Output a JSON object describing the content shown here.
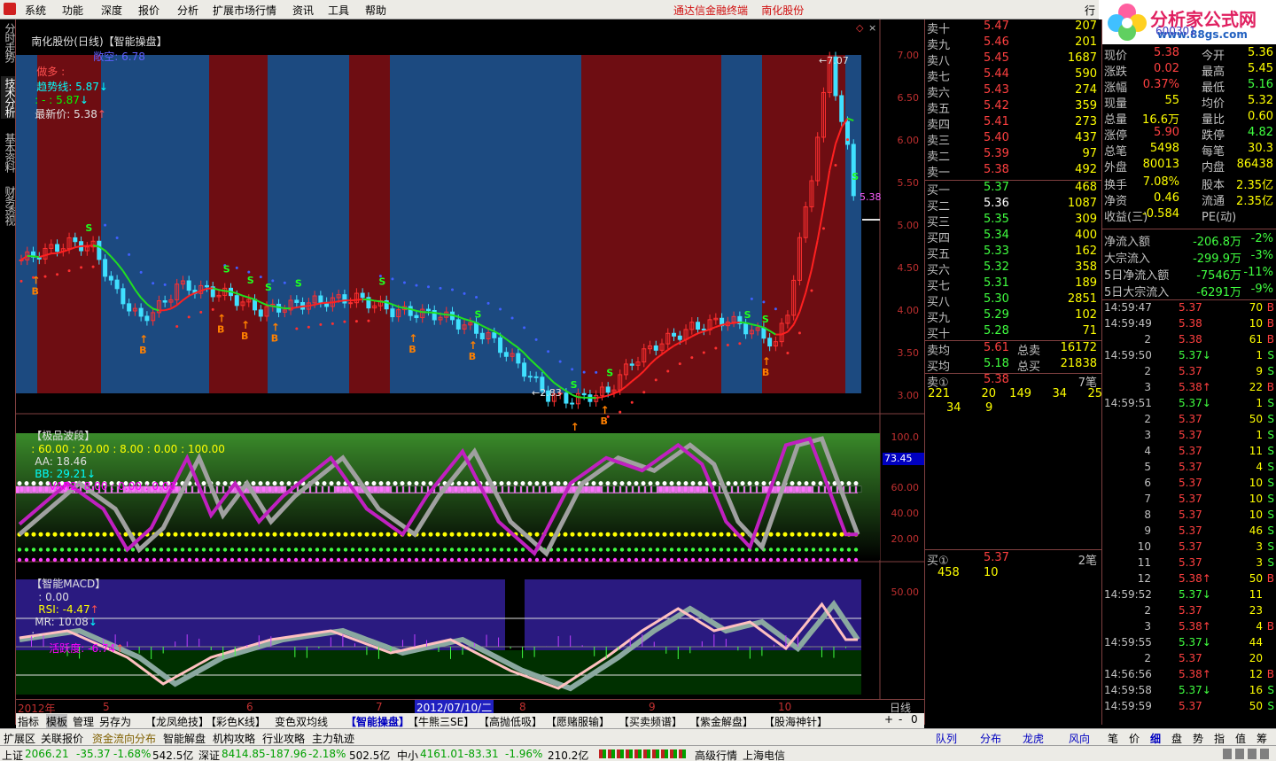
{
  "menu": {
    "items": [
      "系统",
      "功能",
      "深度",
      "报价",
      "分析",
      "扩展市场行情",
      "资讯",
      "工具",
      "帮助"
    ],
    "brand": "通达信金融终端    南化股份",
    "right_tab": "行"
  },
  "logo": {
    "text": "分析家公式网",
    "url": "www.88gs.com",
    "code": "600301"
  },
  "left_tabs": [
    "分时走势",
    "技术分析",
    "基本资料",
    "财务透视"
  ],
  "main_panel": {
    "name": "南化股份(日线)",
    "formula": "【智能操盘】",
    "v1": "敞空: 6.78",
    "v2": "做多 :",
    "v3": "趋势线: 5.87",
    "v4": ": - : 5.87",
    "v5": "最新价: 5.38",
    "price_labels": [
      "7.00",
      "6.50",
      "6.00",
      "5.50",
      "5.00",
      "4.50",
      "4.00",
      "3.50",
      "3.00"
    ],
    "high": "7.07",
    "low": "2.83",
    "last": "5.38"
  },
  "wave_panel": {
    "name": "【极品波段】",
    "v": ": 60.00 : 20.00 : 8.00 : 0.00 : 100.00",
    "aa": "AA: 18.46",
    "bb": "BB: 29.21",
    "var2": "VAR2: 8.00 : 0.00 : 0.00",
    "labels": [
      "100.0",
      "60.00",
      "40.00",
      "20.00"
    ],
    "current": "73.45"
  },
  "macd_panel": {
    "name": "【智能MACD】",
    "v": ": 0.00",
    "rsi": "RSI: -4.47",
    "mr": "MR: 10.08",
    "mr2": ": -",
    "act": "活跃度: -6.74",
    "labels": [
      "50.00"
    ]
  },
  "date_axis": {
    "labels": [
      "2012年",
      "5",
      "6",
      "7",
      "2012/07/10/二",
      "8",
      "9",
      "10"
    ],
    "period": "日线"
  },
  "chart_data": {
    "type": "candlestick",
    "title": "南化股份(日线)",
    "ylim": [
      2.8,
      7.2
    ],
    "high": 7.07,
    "low": 2.83,
    "last": 5.38
  },
  "order_book": {
    "asks": [
      {
        "l": "卖十",
        "p": "5.47",
        "v": "207"
      },
      {
        "l": "卖九",
        "p": "5.46",
        "v": "201"
      },
      {
        "l": "卖八",
        "p": "5.45",
        "v": "1687"
      },
      {
        "l": "卖七",
        "p": "5.44",
        "v": "590"
      },
      {
        "l": "卖六",
        "p": "5.43",
        "v": "274"
      },
      {
        "l": "卖五",
        "p": "5.42",
        "v": "359"
      },
      {
        "l": "卖四",
        "p": "5.41",
        "v": "273"
      },
      {
        "l": "卖三",
        "p": "5.40",
        "v": "437"
      },
      {
        "l": "卖二",
        "p": "5.39",
        "v": "97"
      },
      {
        "l": "卖一",
        "p": "5.38",
        "v": "492"
      }
    ],
    "bids": [
      {
        "l": "买一",
        "p": "5.37",
        "v": "468"
      },
      {
        "l": "买二",
        "p": "5.36",
        "v": "1087"
      },
      {
        "l": "买三",
        "p": "5.35",
        "v": "309"
      },
      {
        "l": "买四",
        "p": "5.34",
        "v": "400"
      },
      {
        "l": "买五",
        "p": "5.33",
        "v": "162"
      },
      {
        "l": "买六",
        "p": "5.32",
        "v": "358"
      },
      {
        "l": "买七",
        "p": "5.31",
        "v": "189"
      },
      {
        "l": "买八",
        "p": "5.30",
        "v": "2851"
      },
      {
        "l": "买九",
        "p": "5.29",
        "v": "102"
      },
      {
        "l": "买十",
        "p": "5.28",
        "v": "71"
      }
    ],
    "avg": [
      {
        "l": "卖均",
        "p": "5.61",
        "l2": "总卖",
        "v": "16172"
      },
      {
        "l": "买均",
        "p": "5.18",
        "l2": "总买",
        "v": "21838"
      }
    ],
    "s1": {
      "l": "卖①",
      "p": "5.38",
      "n": "7笔",
      "q": [
        "221",
        "20",
        "149",
        "34",
        "25"
      ],
      "q2": [
        "34",
        "9"
      ]
    },
    "b1": {
      "l": "买①",
      "p": "5.37",
      "n": "2笔",
      "q": [
        "458",
        "10"
      ]
    }
  },
  "stats": [
    {
      "a": "现价",
      "b": "5.38",
      "c": "今开",
      "d": "5.36"
    },
    {
      "a": "涨跌",
      "b": "0.02",
      "c": "最高",
      "d": "5.45"
    },
    {
      "a": "涨幅",
      "b": "0.37%",
      "c": "最低",
      "d": "5.16"
    },
    {
      "a": "现量",
      "b": "55",
      "c": "均价",
      "d": "5.32"
    },
    {
      "a": "总量",
      "b": "16.6万",
      "c": "量比",
      "d": "0.60"
    },
    {
      "a": "涨停",
      "b": "5.90",
      "c": "跌停",
      "d": "4.82"
    },
    {
      "a": "总笔",
      "b": "5498",
      "c": "每笔",
      "d": "30.3"
    },
    {
      "a": "外盘",
      "b": "80013",
      "c": "内盘",
      "d": "86438"
    },
    {
      "a": "换手",
      "b": "7.08%",
      "c": "股本",
      "d": "2.35亿"
    },
    {
      "a": "净资",
      "b": "0.46",
      "c": "流通",
      "d": "2.35亿"
    },
    {
      "a": "收益(三)",
      "b": "-0.584",
      "c": "PE(动)",
      "d": ""
    }
  ],
  "flows": [
    {
      "a": "净流入额",
      "b": "-206.8万",
      "c": "-2%"
    },
    {
      "a": "大宗流入",
      "b": "-299.9万",
      "c": "-3%"
    },
    {
      "a": "5日净流入额",
      "b": "-7546万",
      "c": "-11%"
    },
    {
      "a": "5日大宗流入",
      "b": "-6291万",
      "c": "-9%"
    }
  ],
  "ticks": [
    {
      "t": "14:59:47",
      "p": "5.37",
      "v": "70",
      "s": "B"
    },
    {
      "t": "14:59:49",
      "p": "5.38",
      "v": "10",
      "s": "B"
    },
    {
      "t": "2",
      "p": "5.38",
      "v": "61",
      "s": "B"
    },
    {
      "t": "14:59:50",
      "p": "5.37↓",
      "v": "1",
      "s": "S"
    },
    {
      "t": "2",
      "p": "5.37",
      "v": "9",
      "s": "S"
    },
    {
      "t": "3",
      "p": "5.38↑",
      "v": "22",
      "s": "B"
    },
    {
      "t": "14:59:51",
      "p": "5.37↓",
      "v": "1",
      "s": "S"
    },
    {
      "t": "2",
      "p": "5.37",
      "v": "50",
      "s": "S"
    },
    {
      "t": "3",
      "p": "5.37",
      "v": "1",
      "s": "S"
    },
    {
      "t": "4",
      "p": "5.37",
      "v": "11",
      "s": "S"
    },
    {
      "t": "5",
      "p": "5.37",
      "v": "4",
      "s": "S"
    },
    {
      "t": "6",
      "p": "5.37",
      "v": "10",
      "s": "S"
    },
    {
      "t": "7",
      "p": "5.37",
      "v": "10",
      "s": "S"
    },
    {
      "t": "8",
      "p": "5.37",
      "v": "10",
      "s": "S"
    },
    {
      "t": "9",
      "p": "5.37",
      "v": "46",
      "s": "S"
    },
    {
      "t": "10",
      "p": "5.37",
      "v": "3",
      "s": "S"
    },
    {
      "t": "11",
      "p": "5.37",
      "v": "3",
      "s": "S"
    },
    {
      "t": "12",
      "p": "5.38↑",
      "v": "50",
      "s": "B"
    },
    {
      "t": "14:59:52",
      "p": "5.37↓",
      "v": "11",
      "s": ""
    },
    {
      "t": "2",
      "p": "5.37",
      "v": "23",
      "s": ""
    },
    {
      "t": "3",
      "p": "5.38↑",
      "v": "4",
      "s": "B"
    },
    {
      "t": "14:59:55",
      "p": "5.37↓",
      "v": "44",
      "s": ""
    },
    {
      "t": "2",
      "p": "5.37",
      "v": "20",
      "s": ""
    },
    {
      "t": "14:56:56",
      "p": "5.38↑",
      "v": "12",
      "s": "B"
    },
    {
      "t": "14:59:58",
      "p": "5.37↓",
      "v": "16",
      "s": "S"
    },
    {
      "t": "14:59:59",
      "p": "5.37",
      "v": "50",
      "s": "S"
    }
  ],
  "tabs1": [
    "指标",
    "模板",
    "管理",
    "另存为",
    "【龙凤绝技】",
    "【彩色K线】",
    "变色双均线",
    "【智能操盘】",
    "【牛熊三SE】",
    "【高抛低吸】",
    "【愿赌服输】",
    "【买卖频谱】",
    "【紫金解盘】",
    "【股海神针】"
  ],
  "tabs2": [
    "扩展区",
    "关联报价",
    "资金流向分布",
    "智能解盘",
    "机构攻略",
    "行业攻略",
    "主力轨迹"
  ],
  "quote_tabs": [
    "队列",
    "分布",
    "龙虎",
    "风向"
  ],
  "tick_tabs": [
    "笔",
    "价",
    "细",
    "盘",
    "势",
    "指",
    "值",
    "筹"
  ],
  "status": {
    "sh": "上证",
    "sh_v": "2066.21",
    "sh_c": "-35.37",
    "sh_p": "-1.68%",
    "sh_a": "542.5亿",
    "sz": "深证",
    "sz_v": "8414.85",
    "sz_c": "-187.96",
    "sz_p": "-2.18%",
    "sz_a": "502.5亿",
    "zx": "中小",
    "zx_v": "4161.01",
    "zx_c": "-83.31",
    "zx_p": "-1.96%",
    "zx_a": "210.2亿",
    "srv": "高级行情_上海电信"
  }
}
